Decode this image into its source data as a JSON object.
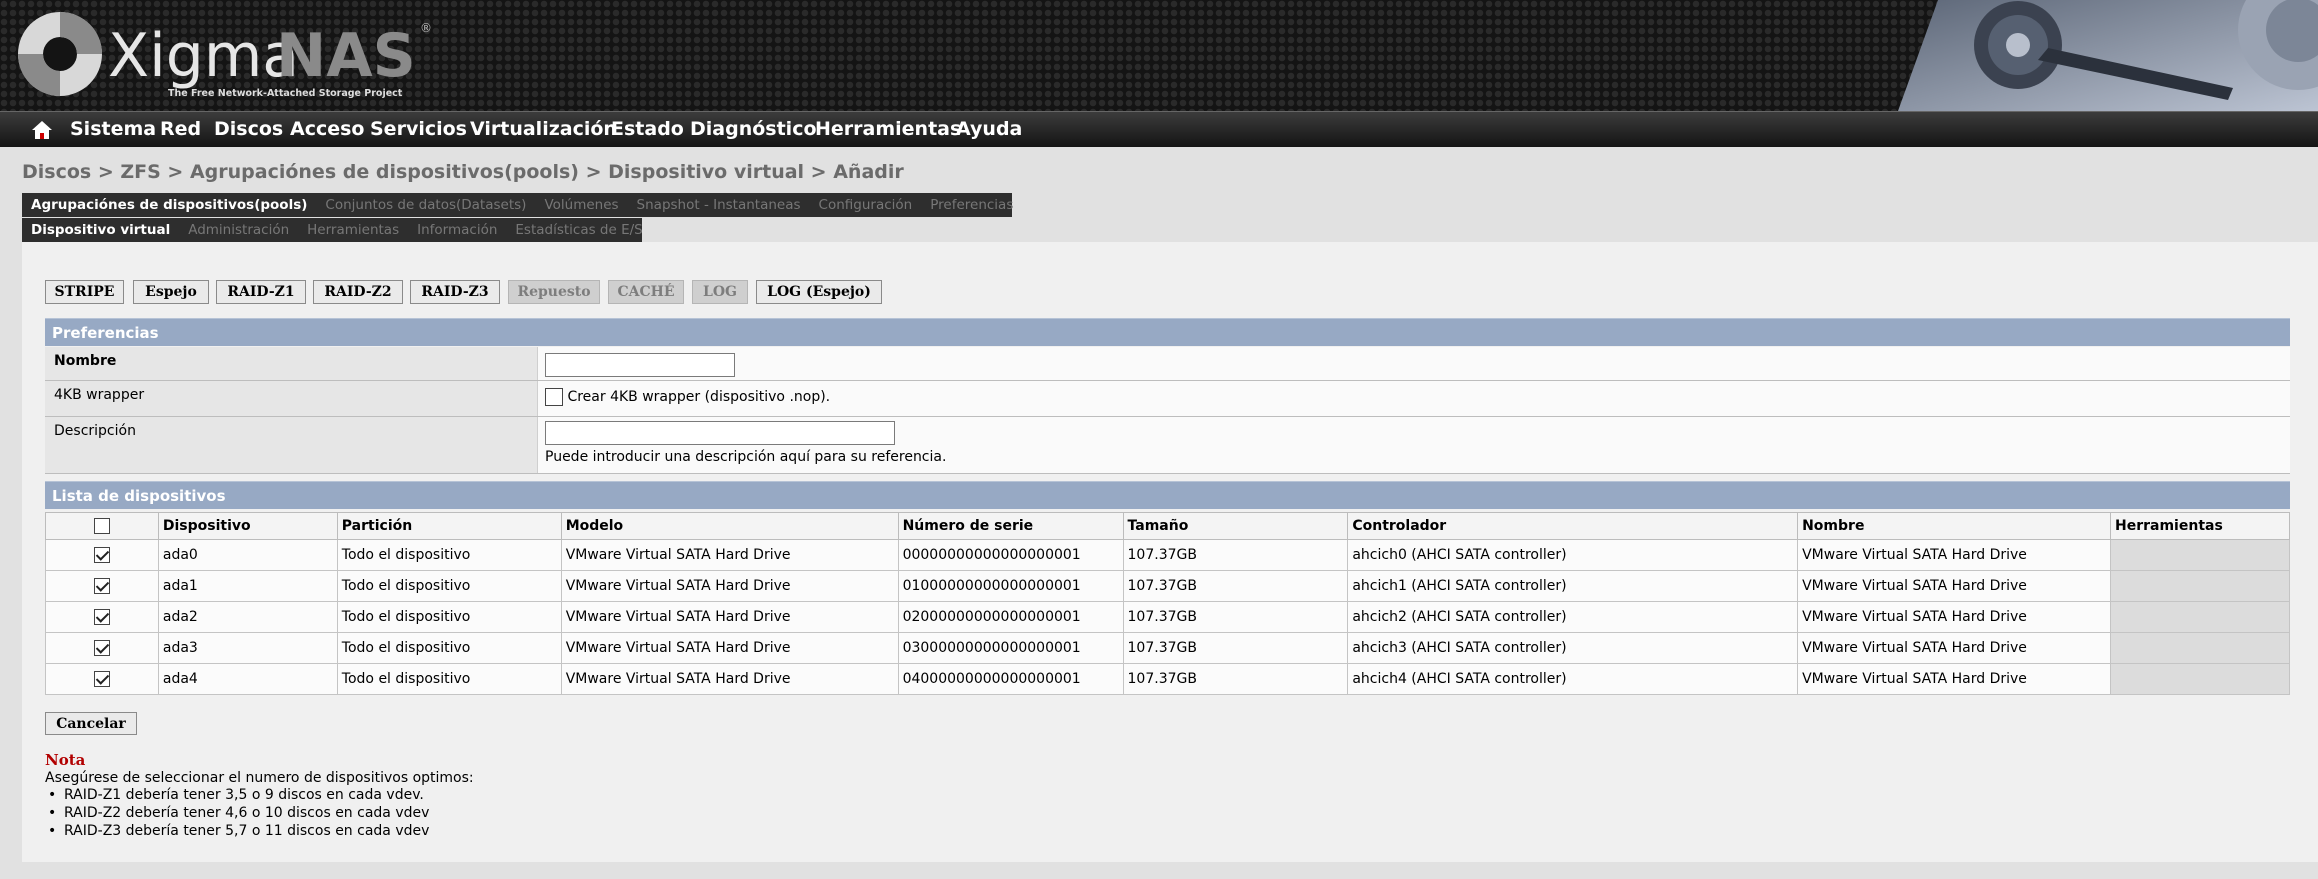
{
  "header": {
    "logo_prefix": "Xigma",
    "logo_suffix": "NAS",
    "logo_trademark": "®",
    "logo_tagline": "The Free Network-Attached Storage Project"
  },
  "menu": [
    "Sistema",
    "Red",
    "Discos",
    "Acceso",
    "Servicios",
    "Virtualización",
    "Estado",
    "Diagnóstico",
    "Herramientas",
    "Ayuda"
  ],
  "breadcrumb": "Discos > ZFS > Agrupaciónes de dispositivos(pools) > Dispositivo virtual > Añadir",
  "tabs_primary": [
    "Agrupaciónes de dispositivos(pools)",
    "Conjuntos de datos(Datasets)",
    "Volúmenes",
    "Snapshot - Instantaneas",
    "Configuración",
    "Preferencias"
  ],
  "tabs_secondary": [
    "Dispositivo virtual",
    "Administración",
    "Herramientas",
    "Información",
    "Estadísticas de E/S"
  ],
  "vdev_types": [
    {
      "label": "STRIPE",
      "enabled": true
    },
    {
      "label": "Espejo",
      "enabled": true
    },
    {
      "label": "RAID-Z1",
      "enabled": true
    },
    {
      "label": "RAID-Z2",
      "enabled": true
    },
    {
      "label": "RAID-Z3",
      "enabled": true
    },
    {
      "label": "Repuesto",
      "enabled": false
    },
    {
      "label": "CACHÉ",
      "enabled": false
    },
    {
      "label": "LOG",
      "enabled": false
    },
    {
      "label": "LOG (Espejo)",
      "enabled": true
    }
  ],
  "preferences": {
    "title": "Preferencias",
    "name_label": "Nombre",
    "name_value": "",
    "wrapper_label": "4KB wrapper",
    "wrapper_checkbox_label": "Crear 4KB wrapper (dispositivo .nop).",
    "wrapper_checked": false,
    "description_label": "Descripción",
    "description_value": "",
    "description_hint": "Puede introducir una descripción aquí para su referencia."
  },
  "device_list": {
    "title": "Lista de dispositivos",
    "columns": [
      "Dispositivo",
      "Partición",
      "Modelo",
      "Número de serie",
      "Tamaño",
      "Controlador",
      "Nombre",
      "Herramientas"
    ],
    "rows": [
      {
        "checked": true,
        "device": "ada0",
        "partition": "Todo el dispositivo",
        "model": "VMware Virtual SATA Hard Drive",
        "serial": "00000000000000000001",
        "size": "107.37GB",
        "controller": "ahcich0 (AHCI SATA controller)",
        "name": "VMware Virtual SATA Hard Drive"
      },
      {
        "checked": true,
        "device": "ada1",
        "partition": "Todo el dispositivo",
        "model": "VMware Virtual SATA Hard Drive",
        "serial": "01000000000000000001",
        "size": "107.37GB",
        "controller": "ahcich1 (AHCI SATA controller)",
        "name": "VMware Virtual SATA Hard Drive"
      },
      {
        "checked": true,
        "device": "ada2",
        "partition": "Todo el dispositivo",
        "model": "VMware Virtual SATA Hard Drive",
        "serial": "02000000000000000001",
        "size": "107.37GB",
        "controller": "ahcich2 (AHCI SATA controller)",
        "name": "VMware Virtual SATA Hard Drive"
      },
      {
        "checked": true,
        "device": "ada3",
        "partition": "Todo el dispositivo",
        "model": "VMware Virtual SATA Hard Drive",
        "serial": "03000000000000000001",
        "size": "107.37GB",
        "controller": "ahcich3 (AHCI SATA controller)",
        "name": "VMware Virtual SATA Hard Drive"
      },
      {
        "checked": true,
        "device": "ada4",
        "partition": "Todo el dispositivo",
        "model": "VMware Virtual SATA Hard Drive",
        "serial": "04000000000000000001",
        "size": "107.37GB",
        "controller": "ahcich4 (AHCI SATA controller)",
        "name": "VMware Virtual SATA Hard Drive"
      }
    ]
  },
  "cancel_label": "Cancelar",
  "note": {
    "title": "Nota",
    "text": "Asegúrese de seleccionar el numero de dispositivos optimos:",
    "items": [
      "RAID-Z1 debería tener 3,5 o 9 discos en cada vdev.",
      "RAID-Z2 debería tener 4,6 o 10 discos en cada vdev",
      "RAID-Z3 debería tener 5,7 o 11 discos en cada vdev"
    ]
  },
  "colors": {
    "section_header": "#97a9c4",
    "note_title": "#b20000",
    "logo_nas": "#8a8a8a"
  }
}
